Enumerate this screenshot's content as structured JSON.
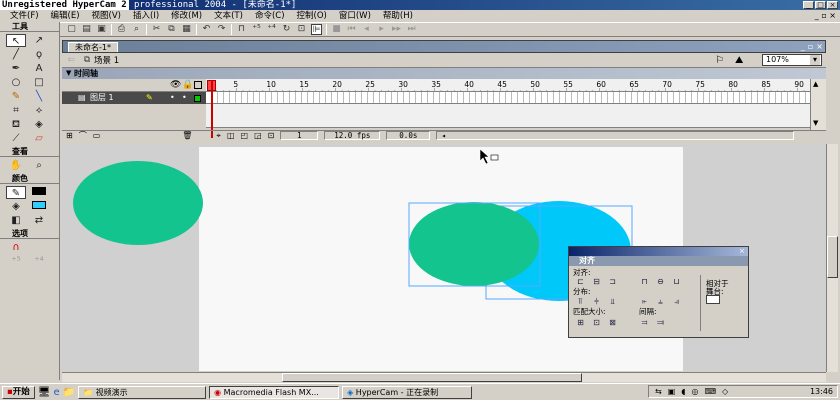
{
  "watermark": "Unregistered HyperCam 2",
  "window": {
    "title": "professional 2004 - [未命名-1*]"
  },
  "menu": [
    "文件(F)",
    "编辑(E)",
    "视图(V)",
    "插入(I)",
    "修改(M)",
    "文本(T)",
    "命令(C)",
    "控制(O)",
    "窗口(W)",
    "帮助(H)"
  ],
  "toolbar_icons": [
    "new-icon",
    "open-icon",
    "save-icon",
    "print-icon",
    "cut-icon",
    "copy-icon",
    "paste-icon",
    "undo-icon",
    "redo-icon",
    "snap-icon",
    "smooth-icon",
    "straighten-icon",
    "rotate-icon",
    "scale-icon",
    "align-icon"
  ],
  "tools_panel": {
    "title": "工具",
    "view_title": "查看",
    "colors_title": "颜色",
    "options_title": "选项"
  },
  "doc": {
    "tab": "未命名-1*",
    "scene": "场景 1",
    "zoom": "107%"
  },
  "timeline": {
    "title": "时间轴",
    "layer_name": "图层 1",
    "ruler_numbers": [
      "5",
      "10",
      "15",
      "20",
      "25",
      "30",
      "35",
      "40",
      "45",
      "50",
      "55",
      "60",
      "65",
      "70",
      "75",
      "80",
      "85",
      "90"
    ],
    "current_frame": "1",
    "fps": "12.0 fps",
    "elapsed": "0.0s"
  },
  "align_panel": {
    "title": "对齐",
    "align_label": "对齐:",
    "distribute_label": "分布:",
    "match_size_label": "匹配大小:",
    "space_label": "间隔:",
    "relative_label_1": "相对于",
    "relative_label_2": "舞台:"
  },
  "stage_shapes": {
    "colors": {
      "green": "#13c48e",
      "cyan": "#00c8f8",
      "stroke": "#000000",
      "fill": "#33ccff"
    }
  },
  "taskbar": {
    "start": "开始",
    "items": [
      "视频演示",
      "Macromedia Flash MX...",
      "HyperCam - 正在录制"
    ],
    "clock": "13:46"
  }
}
